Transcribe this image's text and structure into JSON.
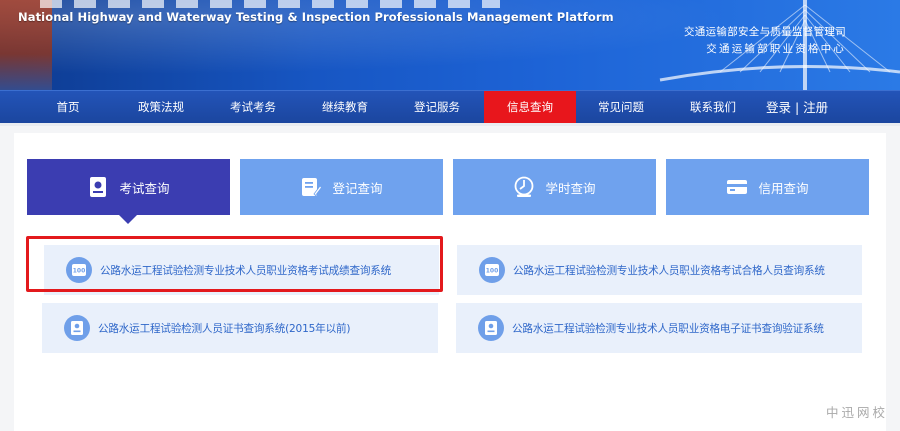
{
  "banner": {
    "en_title": "National Highway and Waterway Testing & Inspection Professionals Management Platform",
    "org_line_1": "交通运输部安全与质量监督管理司",
    "org_line_2": "交通运输部职业资格中心"
  },
  "nav": {
    "items": [
      {
        "label": "首页"
      },
      {
        "label": "政策法规"
      },
      {
        "label": "考试考务"
      },
      {
        "label": "继续教育"
      },
      {
        "label": "登记服务"
      },
      {
        "label": "信息查询",
        "active": true
      },
      {
        "label": "常见问题"
      },
      {
        "label": "联系我们"
      }
    ],
    "auth": "登录 | 注册",
    "active_color": "#e8161c"
  },
  "tabs": [
    {
      "label": "考试查询",
      "icon": "certificate-icon",
      "active": true
    },
    {
      "label": "登记查询",
      "icon": "document-edit-icon"
    },
    {
      "label": "学时查询",
      "icon": "clock-stamp-icon"
    },
    {
      "label": "信用查询",
      "icon": "credit-card-icon"
    }
  ],
  "links": [
    {
      "label": "公路水运工程试验检测专业技术人员职业资格考试成绩查询系统",
      "icon": "score-100-icon",
      "highlighted": true
    },
    {
      "label": "公路水运工程试验检测专业技术人员职业资格考试合格人员查询系统",
      "icon": "score-100-icon"
    },
    {
      "label": "公路水运工程试验检测人员证书查询系统(2015年以前)",
      "icon": "certificate-icon"
    },
    {
      "label": "公路水运工程试验检测专业技术人员职业资格电子证书查询验证系统",
      "icon": "certificate-icon"
    }
  ],
  "circle_badge_text": "100",
  "watermark": "中迅网校",
  "colors": {
    "tab_active": "#3b3db1",
    "tab_inactive": "#6fa2ee",
    "link_text": "#2f67c9",
    "highlight_border": "#e3191c"
  }
}
